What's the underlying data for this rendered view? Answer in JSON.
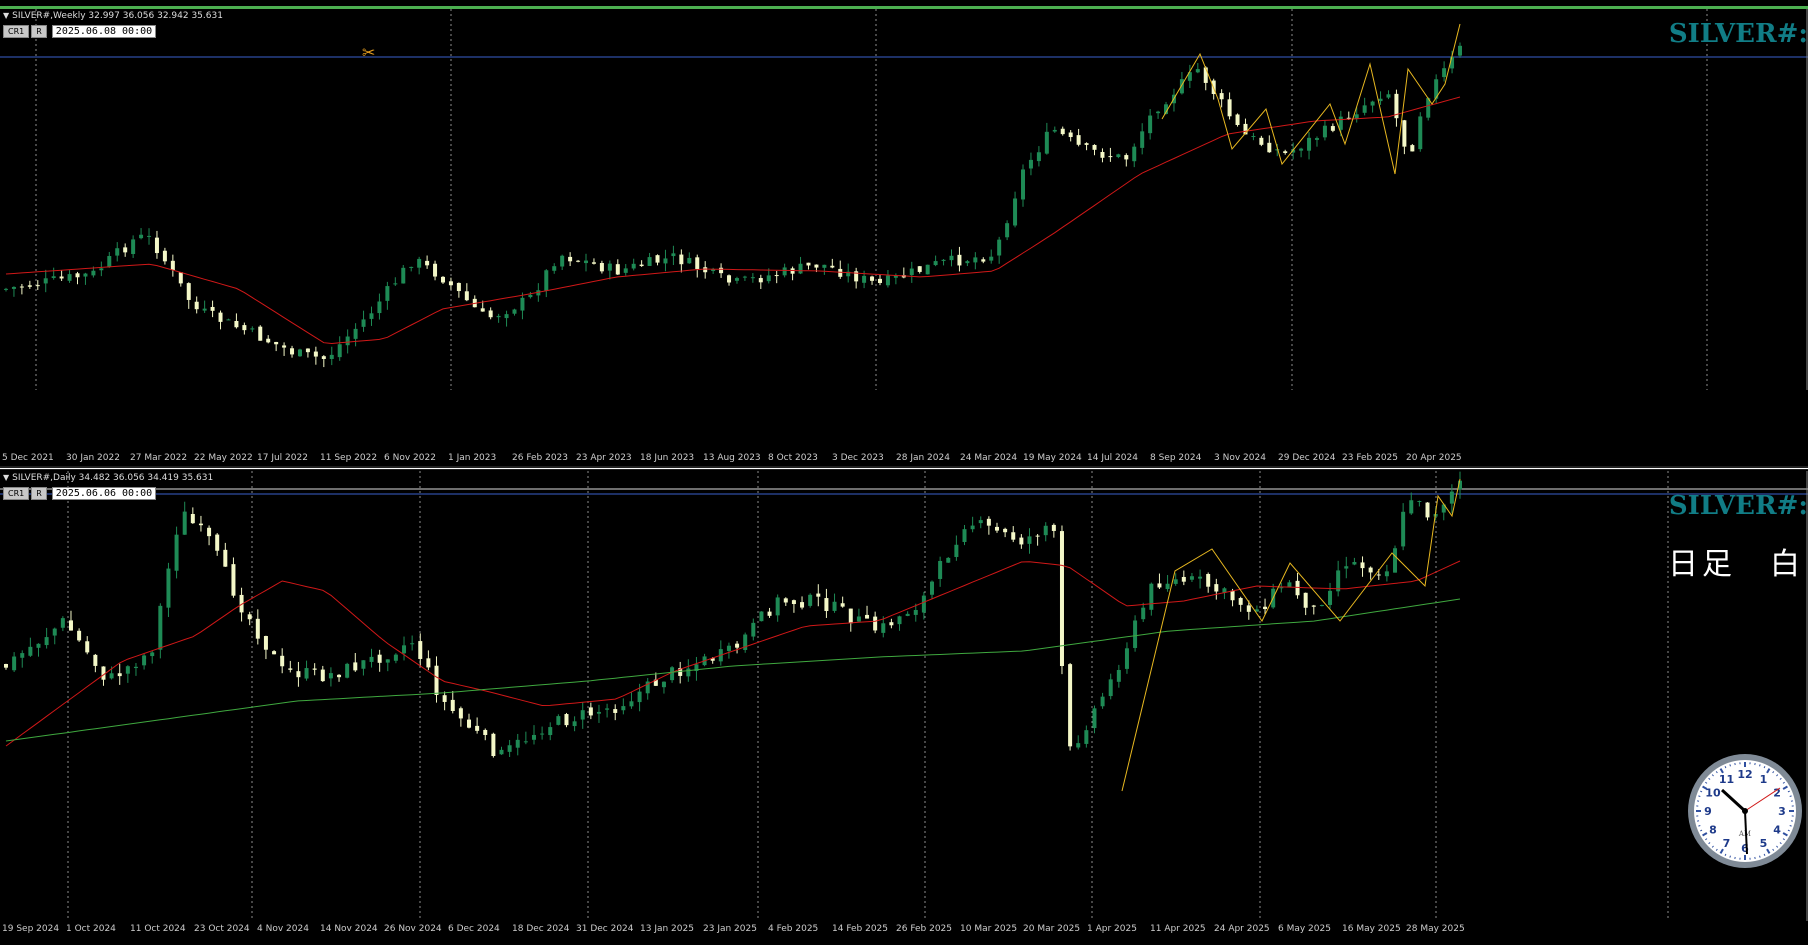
{
  "weekly": {
    "header": "SILVER#,Weekly  32.997 36.056 32.942 35.631",
    "btn_cr1": "CR1",
    "btn_r": "R",
    "date": "2025.06.08 00:00",
    "big_title": "SILVER#:",
    "axis_labels": [
      "5 Dec 2021",
      "30 Jan 2022",
      "27 Mar 2022",
      "22 May 2022",
      "17 Jul 2022",
      "11 Sep 2022",
      "6 Nov 2022",
      "1 Jan 2023",
      "26 Feb 2023",
      "23 Apr 2023",
      "18 Jun 2023",
      "13 Aug 2023",
      "8 Oct 2023",
      "3 Dec 2023",
      "28 Jan 2024",
      "24 Mar 2024",
      "19 May 2024",
      "14 Jul 2024",
      "8 Sep 2024",
      "3 Nov 2024",
      "29 Dec 2024",
      "23 Feb 2025",
      "20 Apr 2025"
    ]
  },
  "daily": {
    "header": "SILVER#,Daily  34.482 36.056 34.419 35.631",
    "btn_cr1": "CR1",
    "btn_r": "R",
    "date": "2025.06.06 00:00",
    "big_title": "SILVER#:",
    "jp_label": "日足　白",
    "axis_labels": [
      "19 Sep 2024",
      "1 Oct 2024",
      "11 Oct 2024",
      "23 Oct 2024",
      "4 Nov 2024",
      "14 Nov 2024",
      "26 Nov 2024",
      "6 Dec 2024",
      "18 Dec 2024",
      "31 Dec 2024",
      "13 Jan 2025",
      "23 Jan 2025",
      "4 Feb 2025",
      "14 Feb 2025",
      "26 Feb 2025",
      "10 Mar 2025",
      "20 Mar 2025",
      "1 Apr 2025",
      "11 Apr 2025",
      "24 Apr 2025",
      "6 May 2025",
      "16 May 2025",
      "28 May 2025"
    ]
  },
  "clock": {
    "numerals": [
      "12",
      "1",
      "2",
      "3",
      "4",
      "5",
      "6",
      "7",
      "8",
      "9",
      "10",
      "11"
    ],
    "ampm": "AM"
  },
  "colors": {
    "bull": "#1e8a55",
    "bear": "#f4f8c8",
    "ma_fast": "#d01818",
    "ma_slow": "#3fa83f",
    "zigzag": "#e8b820",
    "hline": "#3a5fcd",
    "title": "#117d86",
    "grid": "#b0b0b0"
  }
}
